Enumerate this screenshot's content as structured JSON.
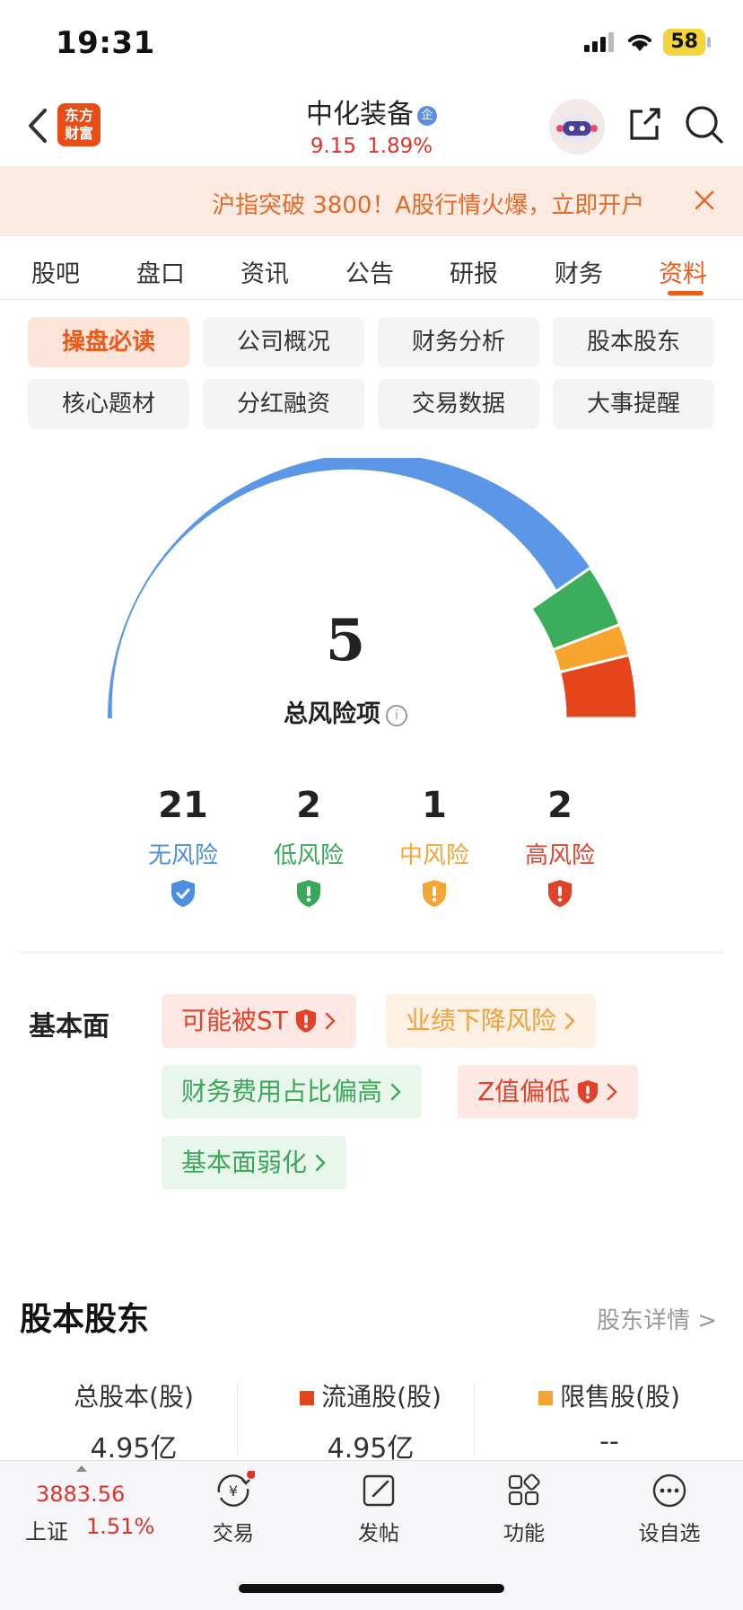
{
  "status": {
    "time": "19:31",
    "battery": "58"
  },
  "header": {
    "logo_line1": "东方",
    "logo_line2": "财富",
    "stock_name": "中化装备",
    "stock_badge": "企",
    "price": "9.15",
    "change_pct": "1.89%"
  },
  "banner": {
    "text": "沪指突破 3800！A股行情火爆，立即开户"
  },
  "tabs": [
    {
      "label": "股吧"
    },
    {
      "label": "盘口"
    },
    {
      "label": "资讯"
    },
    {
      "label": "公告"
    },
    {
      "label": "研报"
    },
    {
      "label": "财务"
    },
    {
      "label": "资料"
    }
  ],
  "chips": [
    {
      "label": "操盘必读"
    },
    {
      "label": "公司概况"
    },
    {
      "label": "财务分析"
    },
    {
      "label": "股本股东"
    },
    {
      "label": "核心题材"
    },
    {
      "label": "分红融资"
    },
    {
      "label": "交易数据"
    },
    {
      "label": "大事提醒"
    }
  ],
  "risk_summary": {
    "total": "5",
    "total_label": "总风险项",
    "info_glyph": "i",
    "gauge_shares": {
      "none": 21,
      "low": 2,
      "medium": 1,
      "high": 2
    },
    "items": [
      {
        "count": "21",
        "label": "无风险",
        "color": "#4a8fe0"
      },
      {
        "count": "2",
        "label": "低风险",
        "color": "#3aa75a"
      },
      {
        "count": "1",
        "label": "中风险",
        "color": "#f5a533"
      },
      {
        "count": "2",
        "label": "高风险",
        "color": "#e0432a"
      }
    ]
  },
  "fundamentals": {
    "label": "基本面",
    "tags": [
      {
        "text": "可能被ST",
        "level": "high"
      },
      {
        "text": "业绩下降风险",
        "level": "medium"
      },
      {
        "text": "财务费用占比偏高",
        "level": "low"
      },
      {
        "text": "Z值偏低",
        "level": "high"
      },
      {
        "text": "基本面弱化",
        "level": "low"
      }
    ]
  },
  "shareholders": {
    "title": "股本股东",
    "link": "股东详情 >",
    "columns": [
      {
        "header": "总股本(股)",
        "value": "4.95亿"
      },
      {
        "header": "流通股(股)",
        "value": "4.95亿"
      },
      {
        "header": "限售股(股)",
        "value": "--"
      }
    ]
  },
  "bottom_bar": {
    "index_value": "3883.56",
    "index_name": "上证",
    "index_pct": "1.51%",
    "buttons": [
      {
        "label": "交易",
        "icon": "trade-icon"
      },
      {
        "label": "发帖",
        "icon": "compose-icon"
      },
      {
        "label": "功能",
        "icon": "grid-icon"
      },
      {
        "label": "设自选",
        "icon": "more-icon"
      }
    ]
  }
}
